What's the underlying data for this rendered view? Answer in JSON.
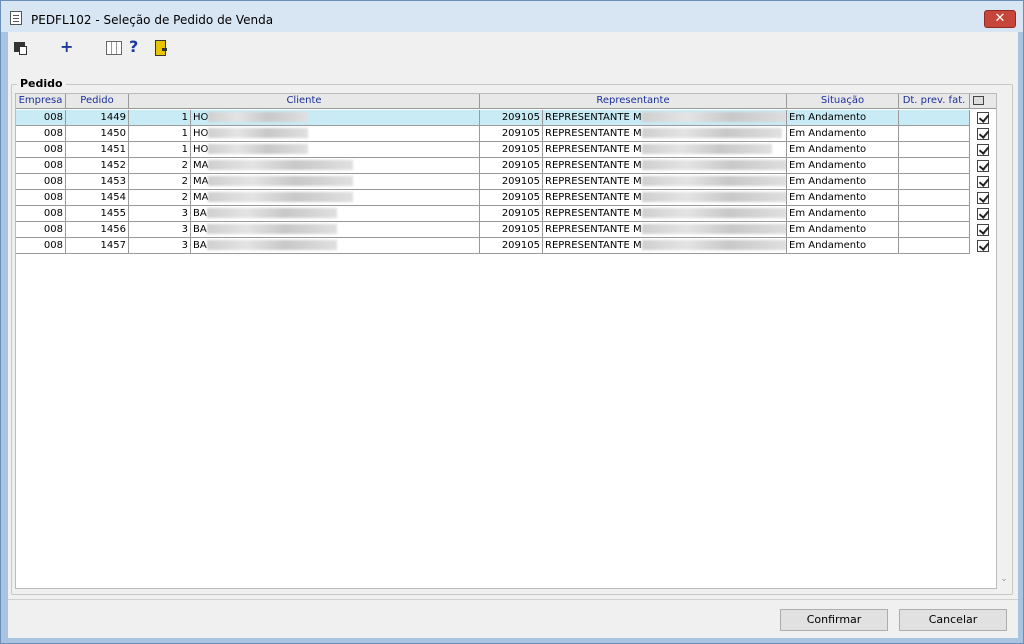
{
  "window": {
    "title": "PEDFL102 - Seleção de Pedido de Venda",
    "close_label": "✕"
  },
  "toolbar": {
    "icons": [
      "select-icon",
      "add-icon",
      "grid-icon",
      "help-icon",
      "exit-icon"
    ],
    "add_glyph": "+",
    "help_glyph": "?"
  },
  "group": {
    "legend": "Pedido"
  },
  "table": {
    "columns": [
      "Empresa",
      "Pedido",
      "Cliente",
      "Representante",
      "Situação",
      "Dt. prev. fat."
    ],
    "rows": [
      {
        "empresa": "008",
        "pedido": "1449",
        "cliente_cod": "1",
        "cliente_nome": "HO",
        "rep_cod": "209105",
        "rep_nome": "REPRESENTANTE M",
        "situacao": "Em Andamento",
        "dt_prev": "",
        "checked": true
      },
      {
        "empresa": "008",
        "pedido": "1450",
        "cliente_cod": "1",
        "cliente_nome": "HO",
        "rep_cod": "209105",
        "rep_nome": "REPRESENTANTE M",
        "situacao": "Em Andamento",
        "dt_prev": "",
        "checked": true
      },
      {
        "empresa": "008",
        "pedido": "1451",
        "cliente_cod": "1",
        "cliente_nome": "HO",
        "rep_cod": "209105",
        "rep_nome": "REPRESENTANTE M",
        "situacao": "Em Andamento",
        "dt_prev": "",
        "checked": true
      },
      {
        "empresa": "008",
        "pedido": "1452",
        "cliente_cod": "2",
        "cliente_nome": "MA",
        "rep_cod": "209105",
        "rep_nome": "REPRESENTANTE M",
        "situacao": "Em Andamento",
        "dt_prev": "",
        "checked": true
      },
      {
        "empresa": "008",
        "pedido": "1453",
        "cliente_cod": "2",
        "cliente_nome": "MA",
        "rep_cod": "209105",
        "rep_nome": "REPRESENTANTE M",
        "situacao": "Em Andamento",
        "dt_prev": "",
        "checked": true
      },
      {
        "empresa": "008",
        "pedido": "1454",
        "cliente_cod": "2",
        "cliente_nome": "MA",
        "rep_cod": "209105",
        "rep_nome": "REPRESENTANTE M",
        "situacao": "Em Andamento",
        "dt_prev": "",
        "checked": true
      },
      {
        "empresa": "008",
        "pedido": "1455",
        "cliente_cod": "3",
        "cliente_nome": "BA",
        "rep_cod": "209105",
        "rep_nome": "REPRESENTANTE M",
        "situacao": "Em Andamento",
        "dt_prev": "",
        "checked": true
      },
      {
        "empresa": "008",
        "pedido": "1456",
        "cliente_cod": "3",
        "cliente_nome": "BA",
        "rep_cod": "209105",
        "rep_nome": "REPRESENTANTE M",
        "situacao": "Em Andamento",
        "dt_prev": "",
        "checked": true
      },
      {
        "empresa": "008",
        "pedido": "1457",
        "cliente_cod": "3",
        "cliente_nome": "BA",
        "rep_cod": "209105",
        "rep_nome": "REPRESENTANTE M",
        "situacao": "Em Andamento",
        "dt_prev": "",
        "checked": true
      }
    ]
  },
  "buttons": {
    "confirm": "Confirmar",
    "cancel": "Cancelar"
  },
  "colors": {
    "selected_row": "#c9ebf5",
    "header_text": "#1a2f9a",
    "close_button": "#c7463c"
  }
}
